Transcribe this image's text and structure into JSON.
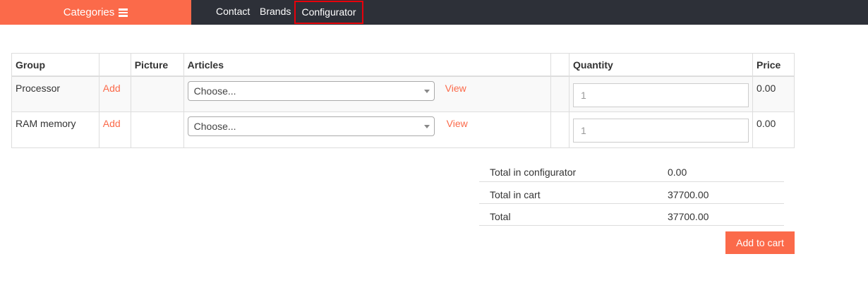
{
  "nav": {
    "categories_label": "Categories",
    "contact": "Contact",
    "brands": "Brands",
    "configurator": "Configurator"
  },
  "table": {
    "headers": {
      "group": "Group",
      "add": "",
      "picture": "Picture",
      "articles": "Articles",
      "blank": "",
      "quantity": "Quantity",
      "price": "Price"
    },
    "rows": [
      {
        "group": "Processor",
        "add": "Add",
        "article": "Choose...",
        "view": "View",
        "quantity": "1",
        "price": "0.00"
      },
      {
        "group": "RAM memory",
        "add": "Add",
        "article": "Choose...",
        "view": "View",
        "quantity": "1",
        "price": "0.00"
      }
    ]
  },
  "totals": [
    {
      "label": "Total in configurator",
      "value": "0.00"
    },
    {
      "label": "Total in cart",
      "value": "37700.00"
    },
    {
      "label": "Total",
      "value": "37700.00"
    }
  ],
  "add_to_cart": "Add to cart",
  "colors": {
    "accent": "#fb6a4a",
    "nav_bg": "#2d3038",
    "highlight_border": "#e8000b"
  }
}
